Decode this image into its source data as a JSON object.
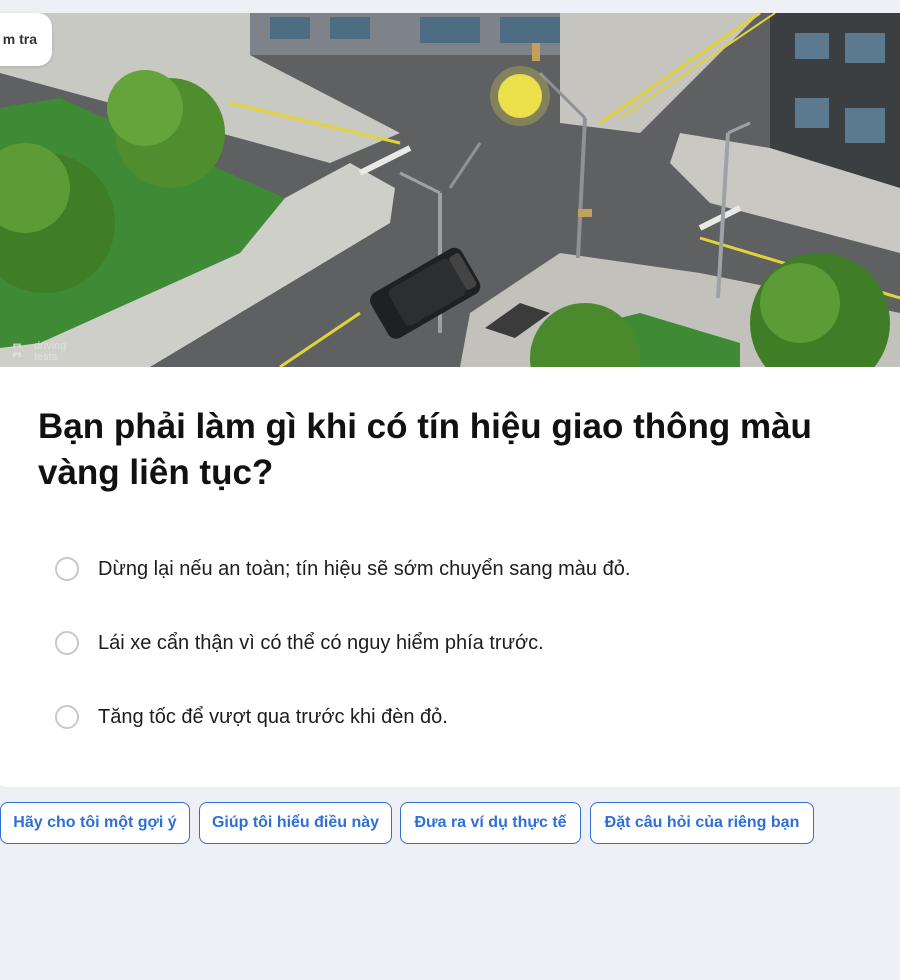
{
  "tag": {
    "label": "m tra"
  },
  "image": {
    "watermark_line1": "driving",
    "watermark_line2": "tests"
  },
  "question": {
    "text": "Bạn phải làm gì khi có tín hiệu giao thông màu vàng liên tục?"
  },
  "options": [
    {
      "label": "Dừng lại nếu an toàn; tín hiệu sẽ sớm chuyển sang màu đỏ."
    },
    {
      "label": "Lái xe cẩn thận vì có thể có nguy hiểm phía trước."
    },
    {
      "label": "Tăng tốc để vượt qua trước khi đèn đỏ."
    }
  ],
  "help_chips": [
    {
      "label": "Hãy cho tôi một gợi ý"
    },
    {
      "label": "Giúp tôi hiểu điều này"
    },
    {
      "label": "Đưa ra ví dụ thực tế"
    },
    {
      "label": "Đặt câu hỏi của riêng bạn"
    }
  ],
  "colors": {
    "accent": "#2f6fd6",
    "background": "#eef0f5",
    "signal": "#f2e64a"
  }
}
